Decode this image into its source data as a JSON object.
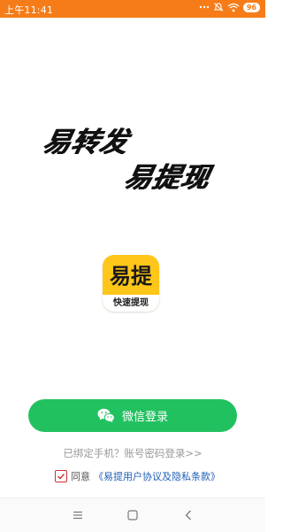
{
  "status_bar": {
    "time": "上午11:41",
    "battery": "96"
  },
  "hero": {
    "line1": "易转发",
    "line2": "易提现"
  },
  "app_icon": {
    "title": "易提",
    "subtitle": "快速提现"
  },
  "login": {
    "wechat_label": "微信登录",
    "phone_login_link": "已绑定手机？账号密码登录>>"
  },
  "agreement": {
    "prefix": "同意",
    "link": "《易提用户协议及隐私条款》",
    "checked": true
  },
  "colors": {
    "status_bar": "#f57c18",
    "wechat_button": "#22c160",
    "link": "#1e5fb4",
    "checkbox_border": "#d32f2f",
    "brand_yellow": "#ffc61a"
  }
}
